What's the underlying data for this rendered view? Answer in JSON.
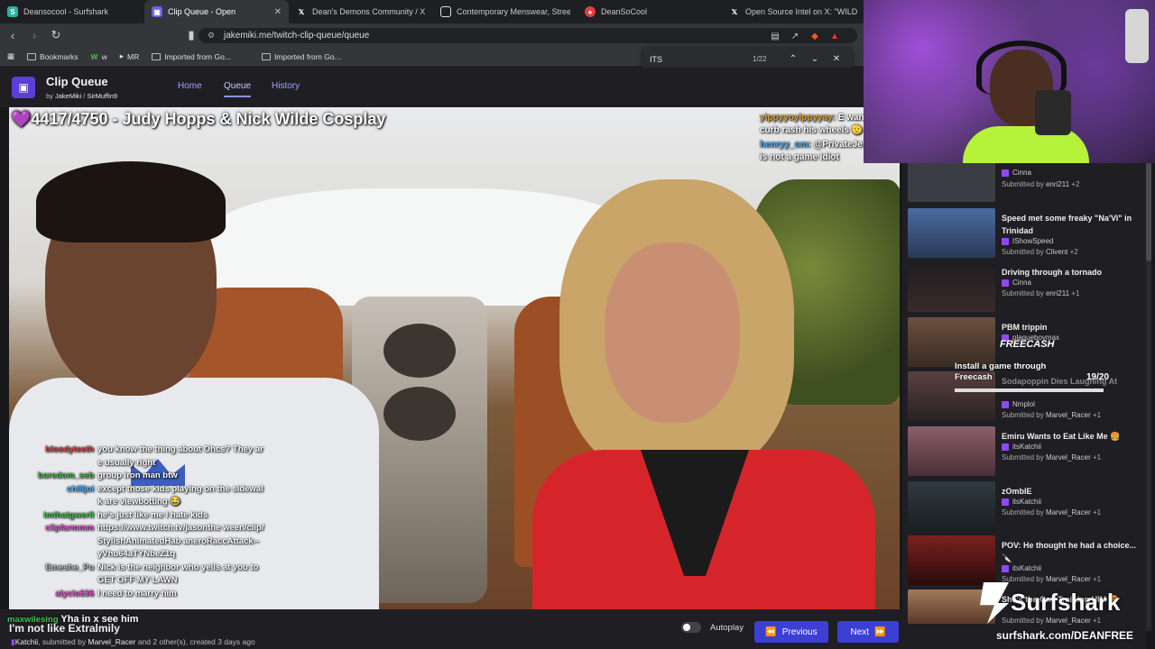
{
  "browser": {
    "tabs": [
      {
        "label": "Deansocool - Surfshark",
        "icon_color": "#2ab0a0"
      },
      {
        "label": "Clip Queue - Open",
        "icon_color": "#6b5fe6",
        "active": true
      },
      {
        "label": "Dean's Demons Community / X",
        "icon_color": "#ffffff"
      },
      {
        "label": "Contemporary Menswear, Streetwear",
        "icon_color": "#dddddd"
      },
      {
        "label": "DeanSoCool",
        "icon_color": "#e33d3d"
      },
      {
        "label": "Open Source Intel on X: \"WILD",
        "icon_color": "#ffffff"
      }
    ],
    "url": "jakemiki.me/twitch-clip-queue/queue",
    "bookmarks": [
      "Bookmarks",
      "w",
      "MR",
      "Imported from Go...",
      "Imported from Go..."
    ],
    "find": {
      "query": "ITS",
      "count": "1/22"
    }
  },
  "app": {
    "title": "Clip Queue",
    "by": "by",
    "author1": "JakeMiki",
    "author2": "SirMuffin9",
    "nav": [
      "Home",
      "Queue",
      "History"
    ]
  },
  "video": {
    "title_heart": "💜",
    "title": "4417/4750 - Judy Hopps & Nick Wilde Cosplay"
  },
  "chat_right": [
    {
      "user": "yippyyoyippyyay:",
      "msg": "E wants some curb rash his wheels 🫡"
    },
    {
      "user": "henryy_om:",
      "msg": "@PrivateJettTV this is not a game idiot"
    }
  ],
  "chat_left": [
    {
      "user": "bloodyteeth",
      "color": "#e04040",
      "msg": "you know the thing about Ohcs? They are usually right"
    },
    {
      "user": "boredom_seb",
      "color": "#41c14f",
      "msg": "group iron man btw"
    },
    {
      "user": "chilljoi",
      "color": "#4bb1ff",
      "msg": "except those kids playing on the sidewalk are viewbotting 😂"
    },
    {
      "user": "imthatgwerll",
      "color": "#41c14f",
      "msg": "he's just like me I hate kids"
    },
    {
      "user": "clipfarmmm",
      "color": "#e056d6",
      "msg": "https://www.twitch.tv/jasonthe ween/clip/StylishAnimatedHab aneroRaccAttack-- yVhu64aTYNbeZ1q"
    },
    {
      "user": "Emeshe_Pu",
      "color": "#bbbbbb",
      "msg": "Nick is the neighbor who yells at you to GET OFF MY LAWN"
    },
    {
      "user": "alyclo636",
      "color": "#e056d6",
      "msg": "I need to marry him"
    },
    {
      "user": "maxwilesing",
      "color": "#41c14f",
      "msg": "Yha in x see him"
    }
  ],
  "now_playing_text": "I'm not like Extralmily",
  "bottom": {
    "channel": "Katchii",
    "submitted_by_label": ", submitted by",
    "submitter": "Marvel_Racer",
    "suffix": "and 2 other(s), created 3 days ago",
    "autoplay": "Autoplay",
    "prev": "Previous",
    "next": "Next"
  },
  "queue": [
    {
      "title": "",
      "channel": "Cinna",
      "submitted": "Submitted by",
      "user": "enri211",
      "extra": "+2",
      "thumb": "#3b3d44"
    },
    {
      "title": "Speed met some freaky \"Na'Vi\" in Trinidad",
      "channel": "IShowSpeed",
      "submitted": "Submitted by",
      "user": "Clivent",
      "extra": "+2",
      "thumb": "#3e5a8c"
    },
    {
      "title": "Driving through a tornado",
      "channel": "Cinna",
      "submitted": "Submitted by",
      "user": "enri211",
      "extra": "+1",
      "thumb": "#2a2a30"
    },
    {
      "title": "PBM trippin",
      "channel": "plaqueboymax",
      "submitted": "",
      "user": "",
      "extra": "",
      "thumb": "#5a4536"
    },
    {
      "title": "Sodapoppin Dies Laughing At",
      "channel": "Nmplol",
      "submitted": "Submitted by",
      "user": "Marvel_Racer",
      "extra": "+1",
      "thumb": "#4a3a3a"
    },
    {
      "title": "Emiru Wants to Eat Like Me 🍔",
      "channel": "itsKatchii",
      "submitted": "Submitted by",
      "user": "Marvel_Racer",
      "extra": "+1",
      "thumb": "#7a4f5a"
    },
    {
      "title": "zOmbIE",
      "channel": "itsKatchii",
      "submitted": "Submitted by",
      "user": "Marvel_Racer",
      "extra": "+1",
      "thumb": "#2f3a40"
    },
    {
      "title": "POV: He thought he had a choice... 🔪",
      "channel": "itsKatchii",
      "submitted": "Submitted by",
      "user": "Marvel_Racer",
      "extra": "+1",
      "thumb": "#6a2020"
    },
    {
      "title": "She's the One Training HIM 😍",
      "channel": "",
      "submitted": "Submitted by",
      "user": "Marvel_Racer",
      "extra": "+1",
      "thumb": "#8a6a50"
    }
  ],
  "freecash": {
    "logo": "FREECASH",
    "text": "Install a game through Freecash",
    "count": "19/20"
  },
  "surfshark": {
    "name": "Surfshark",
    "url": "surfshark.com/DEANFREE"
  }
}
